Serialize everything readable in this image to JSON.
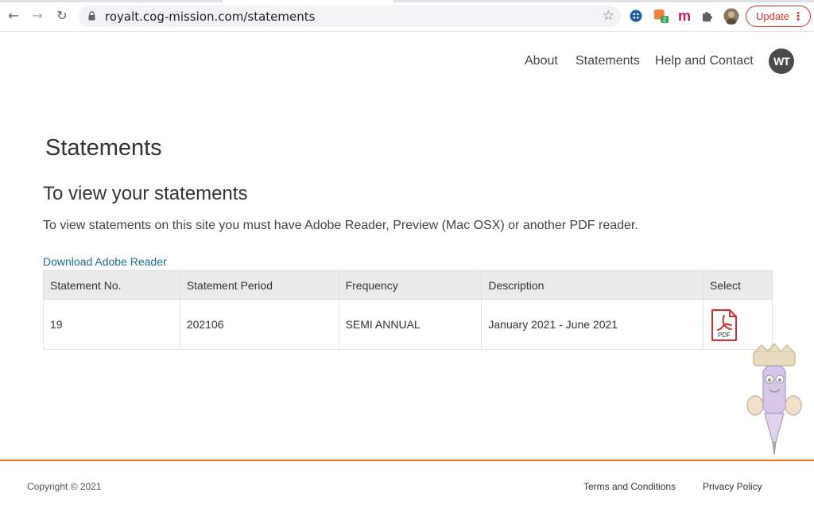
{
  "browser": {
    "url": "royalt.cog-mission.com/statements",
    "update_label": "Update",
    "extension_badge": "2"
  },
  "nav": {
    "about": "About",
    "statements": "Statements",
    "help": "Help and Contact",
    "logo_text": "WT"
  },
  "page": {
    "title": "Statements",
    "section_title": "To view your statements",
    "intro": "To view statements on this site you must have Adobe Reader, Preview (Mac OSX) or another PDF reader.",
    "download_link": "Download Adobe Reader"
  },
  "table": {
    "headers": {
      "statement_no": "Statement No.",
      "period": "Statement Period",
      "frequency": "Frequency",
      "description": "Description",
      "select": "Select"
    },
    "rows": [
      {
        "statement_no": "19",
        "period": "202106",
        "frequency": "SEMI ANNUAL",
        "description": "January 2021 - June 2021",
        "pdf_label": "PDF"
      }
    ]
  },
  "footer": {
    "copyright": "Copyright © 2021",
    "terms": "Terms and Conditions",
    "privacy": "Privacy Policy"
  },
  "colors": {
    "accent_orange": "#e9711c",
    "link_teal": "#1a6e8e",
    "pdf_red": "#d32f2f",
    "update_red": "#d93025"
  }
}
